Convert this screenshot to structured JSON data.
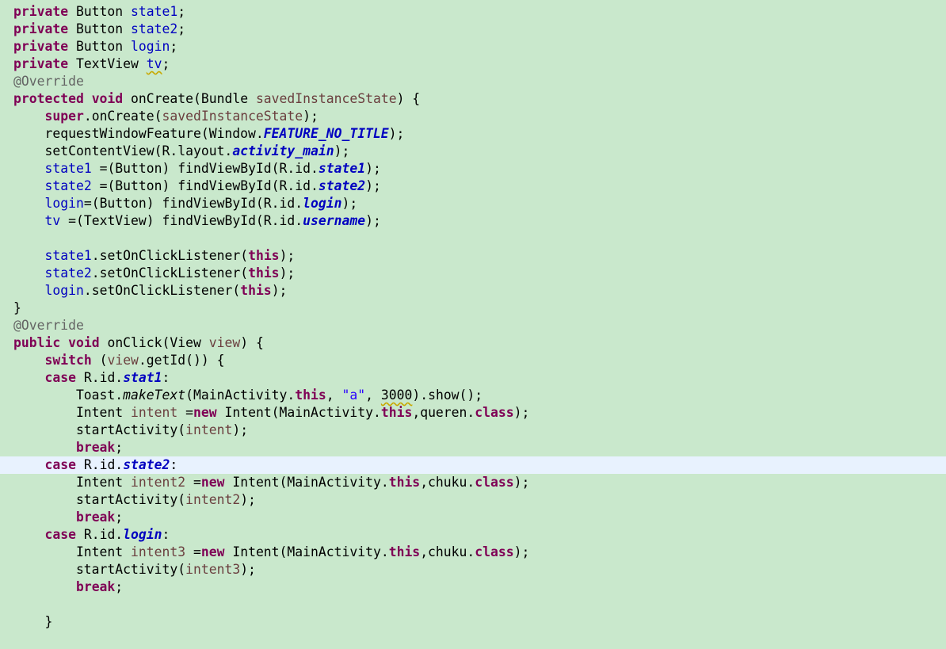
{
  "editor": {
    "colors": {
      "background": "#c9e8cc",
      "current_line": "#e8f2fe",
      "keyword": "#7f0055",
      "field": "#0000c0",
      "variable": "#6a3e3e",
      "annotation": "#646464",
      "string": "#2a00ff"
    },
    "current_line_index": 26,
    "lines": [
      [
        {
          "t": "private",
          "c": "kw"
        },
        {
          "t": " Button "
        },
        {
          "t": "state1",
          "c": "fld"
        },
        {
          "t": ";"
        }
      ],
      [
        {
          "t": "private",
          "c": "kw"
        },
        {
          "t": " Button "
        },
        {
          "t": "state2",
          "c": "fld"
        },
        {
          "t": ";"
        }
      ],
      [
        {
          "t": "private",
          "c": "kw"
        },
        {
          "t": " Button "
        },
        {
          "t": "login",
          "c": "fld"
        },
        {
          "t": ";"
        }
      ],
      [
        {
          "t": "private",
          "c": "kw"
        },
        {
          "t": " TextView "
        },
        {
          "t": "tv",
          "c": "fld warn"
        },
        {
          "t": ";"
        }
      ],
      [
        {
          "t": "@Override",
          "c": "ann"
        }
      ],
      [
        {
          "t": "protected",
          "c": "kw"
        },
        {
          "t": " "
        },
        {
          "t": "void",
          "c": "kw"
        },
        {
          "t": " onCreate(Bundle "
        },
        {
          "t": "savedInstanceState",
          "c": "var"
        },
        {
          "t": ") {"
        }
      ],
      [
        {
          "t": "    "
        },
        {
          "t": "super",
          "c": "kw"
        },
        {
          "t": ".onCreate("
        },
        {
          "t": "savedInstanceState",
          "c": "var"
        },
        {
          "t": ");"
        }
      ],
      [
        {
          "t": "    requestWindowFeature(Window."
        },
        {
          "t": "FEATURE_NO_TITLE",
          "c": "sfld"
        },
        {
          "t": ");"
        }
      ],
      [
        {
          "t": "    setContentView(R.layout."
        },
        {
          "t": "activity_main",
          "c": "sfld"
        },
        {
          "t": ");"
        }
      ],
      [
        {
          "t": "    "
        },
        {
          "t": "state1",
          "c": "fld"
        },
        {
          "t": " =(Button) findViewById(R.id."
        },
        {
          "t": "state1",
          "c": "sfld"
        },
        {
          "t": ");"
        }
      ],
      [
        {
          "t": "    "
        },
        {
          "t": "state2",
          "c": "fld"
        },
        {
          "t": " =(Button) findViewById(R.id."
        },
        {
          "t": "state2",
          "c": "sfld"
        },
        {
          "t": ");"
        }
      ],
      [
        {
          "t": "    "
        },
        {
          "t": "login",
          "c": "fld"
        },
        {
          "t": "=(Button) findViewById(R.id."
        },
        {
          "t": "login",
          "c": "sfld"
        },
        {
          "t": ");"
        }
      ],
      [
        {
          "t": "    "
        },
        {
          "t": "tv",
          "c": "fld"
        },
        {
          "t": " =(TextView) findViewById(R.id."
        },
        {
          "t": "username",
          "c": "sfld"
        },
        {
          "t": ");"
        }
      ],
      [],
      [
        {
          "t": "    "
        },
        {
          "t": "state1",
          "c": "fld"
        },
        {
          "t": ".setOnClickListener("
        },
        {
          "t": "this",
          "c": "kw"
        },
        {
          "t": ");"
        }
      ],
      [
        {
          "t": "    "
        },
        {
          "t": "state2",
          "c": "fld"
        },
        {
          "t": ".setOnClickListener("
        },
        {
          "t": "this",
          "c": "kw"
        },
        {
          "t": ");"
        }
      ],
      [
        {
          "t": "    "
        },
        {
          "t": "login",
          "c": "fld"
        },
        {
          "t": ".setOnClickListener("
        },
        {
          "t": "this",
          "c": "kw"
        },
        {
          "t": ");"
        }
      ],
      [
        {
          "t": "}"
        }
      ],
      [
        {
          "t": "@Override",
          "c": "ann"
        }
      ],
      [
        {
          "t": "public",
          "c": "kw"
        },
        {
          "t": " "
        },
        {
          "t": "void",
          "c": "kw"
        },
        {
          "t": " onClick(View "
        },
        {
          "t": "view",
          "c": "var"
        },
        {
          "t": ") {"
        }
      ],
      [
        {
          "t": "    "
        },
        {
          "t": "switch",
          "c": "kw"
        },
        {
          "t": " ("
        },
        {
          "t": "view",
          "c": "var"
        },
        {
          "t": ".getId()) {"
        }
      ],
      [
        {
          "t": "    "
        },
        {
          "t": "case",
          "c": "kw"
        },
        {
          "t": " R.id."
        },
        {
          "t": "stat1",
          "c": "sfld"
        },
        {
          "t": ":"
        }
      ],
      [
        {
          "t": "        Toast."
        },
        {
          "t": "makeText",
          "c": "sm"
        },
        {
          "t": "(MainActivity."
        },
        {
          "t": "this",
          "c": "kw"
        },
        {
          "t": ", "
        },
        {
          "t": "\"a\"",
          "c": "str"
        },
        {
          "t": ", "
        },
        {
          "t": "3000",
          "c": "warn"
        },
        {
          "t": ").show();"
        }
      ],
      [
        {
          "t": "        Intent "
        },
        {
          "t": "intent",
          "c": "var"
        },
        {
          "t": " ="
        },
        {
          "t": "new",
          "c": "kw"
        },
        {
          "t": " Intent(MainActivity."
        },
        {
          "t": "this",
          "c": "kw"
        },
        {
          "t": ",queren."
        },
        {
          "t": "class",
          "c": "kw"
        },
        {
          "t": ");"
        }
      ],
      [
        {
          "t": "        startActivity("
        },
        {
          "t": "intent",
          "c": "var"
        },
        {
          "t": ");"
        }
      ],
      [
        {
          "t": "        "
        },
        {
          "t": "break",
          "c": "kw"
        },
        {
          "t": ";"
        }
      ],
      [
        {
          "t": "    "
        },
        {
          "t": "case",
          "c": "kw"
        },
        {
          "t": " R.id."
        },
        {
          "t": "state2",
          "c": "sfld"
        },
        {
          "t": ":"
        }
      ],
      [
        {
          "t": "        Intent "
        },
        {
          "t": "intent2",
          "c": "var"
        },
        {
          "t": " ="
        },
        {
          "t": "new",
          "c": "kw"
        },
        {
          "t": " Intent(MainActivity."
        },
        {
          "t": "this",
          "c": "kw"
        },
        {
          "t": ",chuku."
        },
        {
          "t": "class",
          "c": "kw"
        },
        {
          "t": ");"
        }
      ],
      [
        {
          "t": "        startActivity("
        },
        {
          "t": "intent2",
          "c": "var"
        },
        {
          "t": ");"
        }
      ],
      [
        {
          "t": "        "
        },
        {
          "t": "break",
          "c": "kw"
        },
        {
          "t": ";"
        }
      ],
      [
        {
          "t": "    "
        },
        {
          "t": "case",
          "c": "kw"
        },
        {
          "t": " R.id."
        },
        {
          "t": "login",
          "c": "sfld"
        },
        {
          "t": ":"
        }
      ],
      [
        {
          "t": "        Intent "
        },
        {
          "t": "intent3",
          "c": "var"
        },
        {
          "t": " ="
        },
        {
          "t": "new",
          "c": "kw"
        },
        {
          "t": " Intent(MainActivity."
        },
        {
          "t": "this",
          "c": "kw"
        },
        {
          "t": ",chuku."
        },
        {
          "t": "class",
          "c": "kw"
        },
        {
          "t": ");"
        }
      ],
      [
        {
          "t": "        startActivity("
        },
        {
          "t": "intent3",
          "c": "var"
        },
        {
          "t": ");"
        }
      ],
      [
        {
          "t": "        "
        },
        {
          "t": "break",
          "c": "kw"
        },
        {
          "t": ";"
        }
      ],
      [],
      [
        {
          "t": "    }"
        }
      ]
    ]
  }
}
